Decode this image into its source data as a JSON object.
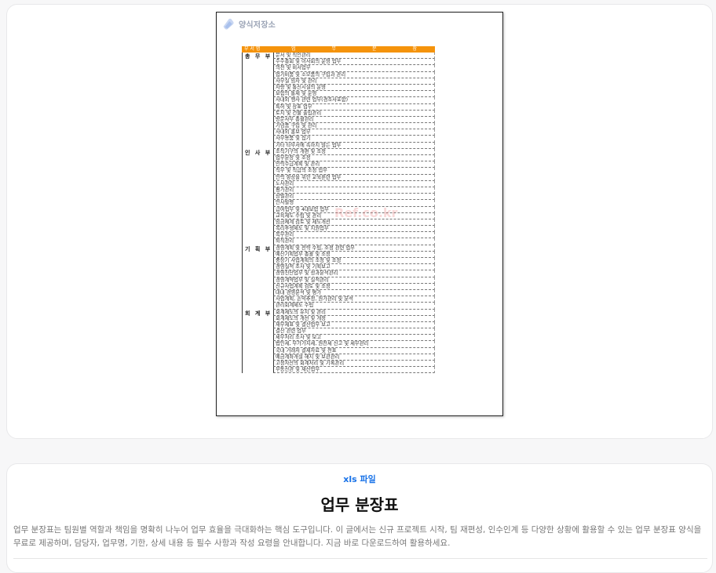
{
  "preview": {
    "logo_text": "양식저장소",
    "watermark": "Ref.co.kr",
    "header": {
      "dept": "부 서 명",
      "task_chars": [
        "업",
        "무",
        "분",
        "장"
      ]
    },
    "departments": [
      {
        "name": "총 무 부",
        "tasks": [
          "문서 및 직인관리",
          "주주총회 및 이사회의 운영 업무",
          "의전 및 비서업무",
          "업기비품 및 소모품의 구입과 관리",
          "사무실 임차 및 관리",
          "차량 및 통신시설의 운영",
          "보험의 통제 및 운영",
          "사내외 행사 관련 업무(경조사포함)",
          "특허 및 상표 업무",
          "토지 및 건물 출입관리",
          "방문사무 총괄관리",
          "기념품 구입 및 관리",
          "사내외 홍보 업무",
          "사무용품 및 집기",
          "기타 타부서에 속하지 않는 업무"
        ]
      },
      {
        "name": "인 사 부",
        "tasks": [
          "조직기구의 개편 및 조정",
          "업무분장 및 조정",
          "인력수급계획 및 관리",
          "직무 및 직급의 조정 업무",
          "인력 향상을 위한 교육훈련 업무",
          "노사관리",
          "평가관리",
          "상벌관리",
          "인사발령",
          "급여업무 및 4대보험 업무",
          "교육제도 수립 및 관리",
          "임금체계 검토 및 제도개선",
          "복리후생제도 및 지원업무",
          "복무관리",
          "퇴직관리"
        ]
      },
      {
        "name": "기 획 부",
        "tasks": [
          "경영계획 및 전략 수립, 조정 관련 업무",
          "예산기획업무 총괄 및 조정",
          "중장기 사업계획의 조정 및 조정",
          "경영실적 조사 및 기획보고",
          "경영진단업무 및 성과분석관리",
          "경영계약업무 및 실적관리",
          "신규사업계획 검토 및 조정",
          "대내 경영분석 및 평가",
          "사업계획, 손익추정, 원가관리 및 분석",
          "관리회계제도 수립"
        ]
      },
      {
        "name": "회 계 부",
        "tasks": [
          "회계제도의 유지 및 관리",
          "회계제도의 개선 및 개정",
          "재무제표 및 결산업무 보고",
          "결산 관련 업무",
          "세무처리 조사 및 보고",
          "법인세, 부가가치세, 원천세 신고 및 세무관리",
          "국내 거래처 결제자료 및 전표",
          "예금계좌개설 해지 및 보관관리",
          "고정자산의 회계처리 및 기록관리",
          "부동산관 및 재산업무"
        ]
      }
    ]
  },
  "info": {
    "file_type": "xls 파일",
    "title": "업무 분장표",
    "description": "업무 분장표는 팀원별 역할과 책임을 명확히 나누어 업무 효율을 극대화하는 핵심 도구입니다. 이 글에서는 신규 프로젝트 시작, 팀 재편성, 인수인계 등 다양한 상황에 활용할 수 있는 업무 분장표 양식을 무료로 제공하며, 담당자, 업무명, 기한, 상세 내용 등 필수 사항과 작성 요령을 안내합니다. 지금 바로 다운로드하여 활용하세요."
  },
  "colors": {
    "header_orange": "#f5930b",
    "accent_blue": "#1a73e8"
  }
}
